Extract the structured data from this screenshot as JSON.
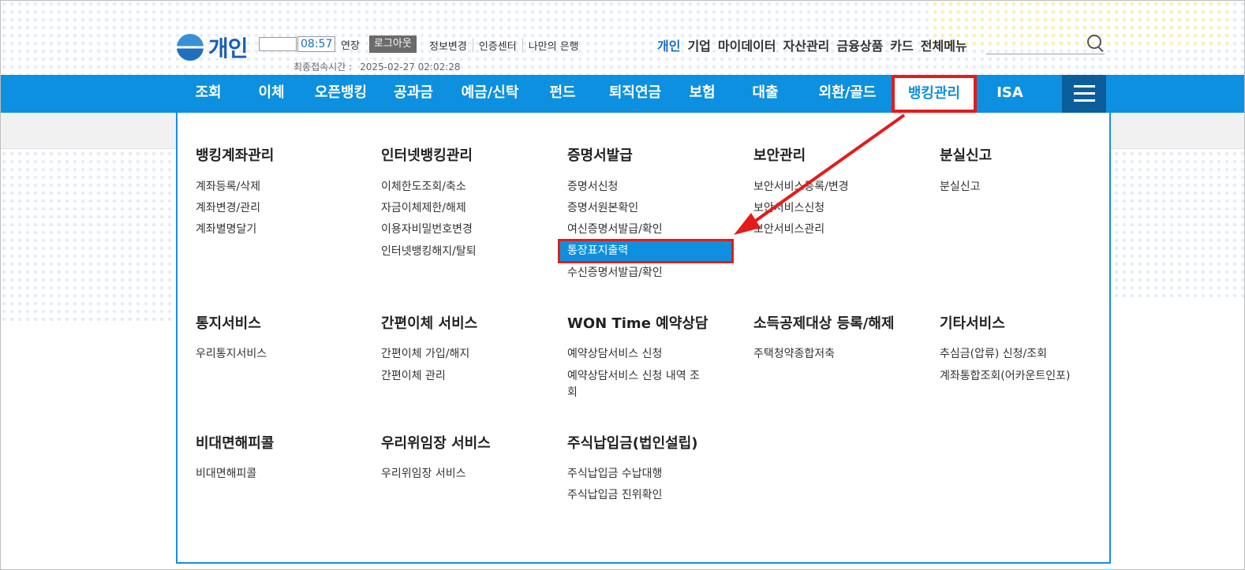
{
  "header": {
    "logo_text": "개인",
    "timer": "08:57",
    "extend_label": "연장",
    "logout_label": "로그아웃",
    "util_links": [
      "정보변경",
      "인증센터",
      "나만의 은행"
    ],
    "last_login_label": "최종접속시간 :",
    "last_login_time": "2025-02-27 02:02:28",
    "top_nav": [
      "개인",
      "기업",
      "마이데이터",
      "자산관리",
      "금융상품",
      "카드",
      "전체메뉴"
    ],
    "top_nav_active": "개인",
    "search_icon": "search-icon"
  },
  "gnb": {
    "items": [
      "조회",
      "이체",
      "오픈뱅킹",
      "공과금",
      "예금/신탁",
      "펀드",
      "퇴직연금",
      "보험",
      "대출",
      "외환/골드",
      "뱅킹관리",
      "ISA"
    ],
    "active": "뱅킹관리",
    "menu_icon": "hamburger-menu-icon",
    "color": "#0d90e0"
  },
  "menu": {
    "sections": [
      {
        "title": "뱅킹계좌관리",
        "links": [
          "계좌등록/삭제",
          "계좌변경/관리",
          "계좌별명달기"
        ]
      },
      {
        "title": "인터넷뱅킹관리",
        "links": [
          "이체한도조회/축소",
          "자금이체제한/해제",
          "이용자비밀번호변경",
          "인터넷뱅킹해지/탈퇴"
        ]
      },
      {
        "title": "증명서발급",
        "links": [
          "증명서신청",
          "증명서원본확인",
          "여신증명서발급/확인",
          "통장표지출력",
          "수신증명서발급/확인"
        ]
      },
      {
        "title": "보안관리",
        "links": [
          "보안서비스등록/변경",
          "보안서비스신청",
          "보안서비스관리"
        ]
      },
      {
        "title": "분실신고",
        "links": [
          "분실신고"
        ]
      },
      {
        "title": "통지서비스",
        "links": [
          "우리통지서비스"
        ]
      },
      {
        "title": "간편이체 서비스",
        "links": [
          "간편이체 가입/해지",
          "간편이체 관리"
        ]
      },
      {
        "title": "WON Time 예약상담",
        "links": [
          "예약상담서비스 신청",
          "예약상담서비스 신청 내역 조",
          "회"
        ]
      },
      {
        "title": "소득공제대상 등록/해제",
        "links": [
          "주택청약종합저축"
        ]
      },
      {
        "title": "기타서비스",
        "links": [
          "추심금(압류) 신청/조회",
          "계좌통합조회(어카운트인포)"
        ]
      },
      {
        "title": "비대면해피콜",
        "links": [
          "비대면해피콜"
        ]
      },
      {
        "title": "우리위임장 서비스",
        "links": [
          "우리위임장 서비스"
        ]
      },
      {
        "title": "주식납입금(법인설립)",
        "links": [
          "주식납입금 수납대행",
          "주식납입금 진위확인"
        ]
      }
    ],
    "highlighted_link": "통장표지출력",
    "highlight_color": "#e41b1b"
  }
}
